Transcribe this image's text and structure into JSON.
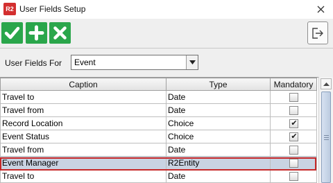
{
  "window": {
    "app_badge": "R2",
    "title": "User Fields Setup"
  },
  "toolbar": {
    "ok_icon": "check-icon",
    "add_icon": "plus-icon",
    "delete_icon": "x-icon",
    "exit_icon": "exit-icon",
    "accent_color": "#2aa64b"
  },
  "filter": {
    "label": "User Fields For",
    "value": "Event"
  },
  "table": {
    "columns": [
      "Caption",
      "Type",
      "Mandatory"
    ],
    "rows": [
      {
        "caption": "Travel to",
        "type": "Date",
        "mandatory": false
      },
      {
        "caption": "Travel from",
        "type": "Date",
        "mandatory": false
      },
      {
        "caption": "Record Location",
        "type": "Choice",
        "mandatory": true
      },
      {
        "caption": "Event Status",
        "type": "Choice",
        "mandatory": true
      },
      {
        "caption": "Travel from",
        "type": "Date",
        "mandatory": false
      },
      {
        "caption": "Event Manager",
        "type": "R2Entity",
        "mandatory": false
      },
      {
        "caption": "Travel to",
        "type": "Date",
        "mandatory": false
      }
    ],
    "selected_row": 5,
    "highlight_color": "#c62828"
  }
}
